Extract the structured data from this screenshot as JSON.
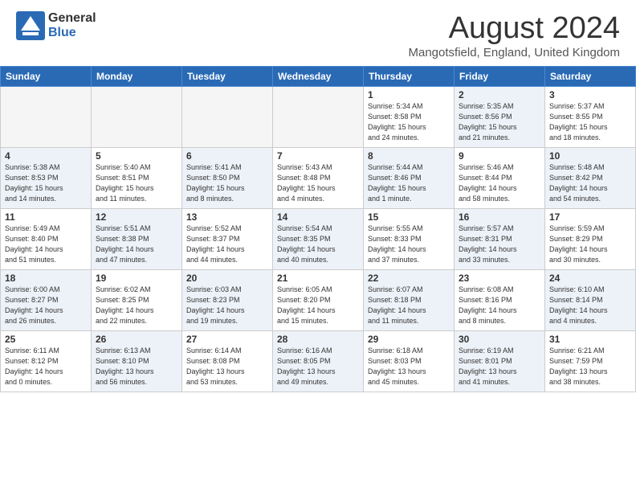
{
  "header": {
    "logo": {
      "general": "General",
      "blue": "Blue"
    },
    "title": "August 2024",
    "location": "Mangotsfield, England, United Kingdom"
  },
  "calendar": {
    "days_of_week": [
      "Sunday",
      "Monday",
      "Tuesday",
      "Wednesday",
      "Thursday",
      "Friday",
      "Saturday"
    ],
    "weeks": [
      [
        {
          "day": "",
          "info": "",
          "shade": false,
          "empty": true
        },
        {
          "day": "",
          "info": "",
          "shade": false,
          "empty": true
        },
        {
          "day": "",
          "info": "",
          "shade": false,
          "empty": true
        },
        {
          "day": "",
          "info": "",
          "shade": false,
          "empty": true
        },
        {
          "day": "1",
          "info": "Sunrise: 5:34 AM\nSunset: 8:58 PM\nDaylight: 15 hours\nand 24 minutes.",
          "shade": false
        },
        {
          "day": "2",
          "info": "Sunrise: 5:35 AM\nSunset: 8:56 PM\nDaylight: 15 hours\nand 21 minutes.",
          "shade": true
        },
        {
          "day": "3",
          "info": "Sunrise: 5:37 AM\nSunset: 8:55 PM\nDaylight: 15 hours\nand 18 minutes.",
          "shade": false
        }
      ],
      [
        {
          "day": "4",
          "info": "Sunrise: 5:38 AM\nSunset: 8:53 PM\nDaylight: 15 hours\nand 14 minutes.",
          "shade": true
        },
        {
          "day": "5",
          "info": "Sunrise: 5:40 AM\nSunset: 8:51 PM\nDaylight: 15 hours\nand 11 minutes.",
          "shade": false
        },
        {
          "day": "6",
          "info": "Sunrise: 5:41 AM\nSunset: 8:50 PM\nDaylight: 15 hours\nand 8 minutes.",
          "shade": true
        },
        {
          "day": "7",
          "info": "Sunrise: 5:43 AM\nSunset: 8:48 PM\nDaylight: 15 hours\nand 4 minutes.",
          "shade": false
        },
        {
          "day": "8",
          "info": "Sunrise: 5:44 AM\nSunset: 8:46 PM\nDaylight: 15 hours\nand 1 minute.",
          "shade": true
        },
        {
          "day": "9",
          "info": "Sunrise: 5:46 AM\nSunset: 8:44 PM\nDaylight: 14 hours\nand 58 minutes.",
          "shade": false
        },
        {
          "day": "10",
          "info": "Sunrise: 5:48 AM\nSunset: 8:42 PM\nDaylight: 14 hours\nand 54 minutes.",
          "shade": true
        }
      ],
      [
        {
          "day": "11",
          "info": "Sunrise: 5:49 AM\nSunset: 8:40 PM\nDaylight: 14 hours\nand 51 minutes.",
          "shade": false
        },
        {
          "day": "12",
          "info": "Sunrise: 5:51 AM\nSunset: 8:38 PM\nDaylight: 14 hours\nand 47 minutes.",
          "shade": true
        },
        {
          "day": "13",
          "info": "Sunrise: 5:52 AM\nSunset: 8:37 PM\nDaylight: 14 hours\nand 44 minutes.",
          "shade": false
        },
        {
          "day": "14",
          "info": "Sunrise: 5:54 AM\nSunset: 8:35 PM\nDaylight: 14 hours\nand 40 minutes.",
          "shade": true
        },
        {
          "day": "15",
          "info": "Sunrise: 5:55 AM\nSunset: 8:33 PM\nDaylight: 14 hours\nand 37 minutes.",
          "shade": false
        },
        {
          "day": "16",
          "info": "Sunrise: 5:57 AM\nSunset: 8:31 PM\nDaylight: 14 hours\nand 33 minutes.",
          "shade": true
        },
        {
          "day": "17",
          "info": "Sunrise: 5:59 AM\nSunset: 8:29 PM\nDaylight: 14 hours\nand 30 minutes.",
          "shade": false
        }
      ],
      [
        {
          "day": "18",
          "info": "Sunrise: 6:00 AM\nSunset: 8:27 PM\nDaylight: 14 hours\nand 26 minutes.",
          "shade": true
        },
        {
          "day": "19",
          "info": "Sunrise: 6:02 AM\nSunset: 8:25 PM\nDaylight: 14 hours\nand 22 minutes.",
          "shade": false
        },
        {
          "day": "20",
          "info": "Sunrise: 6:03 AM\nSunset: 8:23 PM\nDaylight: 14 hours\nand 19 minutes.",
          "shade": true
        },
        {
          "day": "21",
          "info": "Sunrise: 6:05 AM\nSunset: 8:20 PM\nDaylight: 14 hours\nand 15 minutes.",
          "shade": false
        },
        {
          "day": "22",
          "info": "Sunrise: 6:07 AM\nSunset: 8:18 PM\nDaylight: 14 hours\nand 11 minutes.",
          "shade": true
        },
        {
          "day": "23",
          "info": "Sunrise: 6:08 AM\nSunset: 8:16 PM\nDaylight: 14 hours\nand 8 minutes.",
          "shade": false
        },
        {
          "day": "24",
          "info": "Sunrise: 6:10 AM\nSunset: 8:14 PM\nDaylight: 14 hours\nand 4 minutes.",
          "shade": true
        }
      ],
      [
        {
          "day": "25",
          "info": "Sunrise: 6:11 AM\nSunset: 8:12 PM\nDaylight: 14 hours\nand 0 minutes.",
          "shade": false
        },
        {
          "day": "26",
          "info": "Sunrise: 6:13 AM\nSunset: 8:10 PM\nDaylight: 13 hours\nand 56 minutes.",
          "shade": true
        },
        {
          "day": "27",
          "info": "Sunrise: 6:14 AM\nSunset: 8:08 PM\nDaylight: 13 hours\nand 53 minutes.",
          "shade": false
        },
        {
          "day": "28",
          "info": "Sunrise: 6:16 AM\nSunset: 8:05 PM\nDaylight: 13 hours\nand 49 minutes.",
          "shade": true
        },
        {
          "day": "29",
          "info": "Sunrise: 6:18 AM\nSunset: 8:03 PM\nDaylight: 13 hours\nand 45 minutes.",
          "shade": false
        },
        {
          "day": "30",
          "info": "Sunrise: 6:19 AM\nSunset: 8:01 PM\nDaylight: 13 hours\nand 41 minutes.",
          "shade": true
        },
        {
          "day": "31",
          "info": "Sunrise: 6:21 AM\nSunset: 7:59 PM\nDaylight: 13 hours\nand 38 minutes.",
          "shade": false
        }
      ]
    ]
  }
}
